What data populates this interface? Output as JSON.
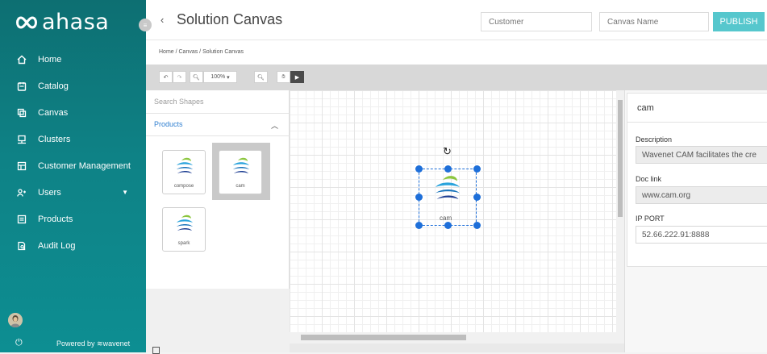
{
  "sidebar": {
    "brand": "ahasa",
    "items": [
      {
        "label": "Home",
        "icon": "home-icon"
      },
      {
        "label": "Catalog",
        "icon": "catalog-icon"
      },
      {
        "label": "Canvas",
        "icon": "canvas-icon"
      },
      {
        "label": "Clusters",
        "icon": "clusters-icon"
      },
      {
        "label": "Customer Management",
        "icon": "customer-management-icon"
      },
      {
        "label": "Users",
        "icon": "users-icon"
      },
      {
        "label": "Products",
        "icon": "products-icon"
      },
      {
        "label": "Audit Log",
        "icon": "audit-log-icon"
      }
    ],
    "powered_by": "Powered by",
    "powered_brand": "wavenet"
  },
  "header": {
    "back_glyph": "‹",
    "title": "Solution Canvas",
    "customer_placeholder": "Customer",
    "canvas_name_placeholder": "Canvas Name",
    "publish_label": "PUBLISH"
  },
  "breadcrumb": "Home / Canvas / Solution Canvas",
  "toolbar": {
    "zoom": "100%"
  },
  "shapes_panel": {
    "search_placeholder": "Search Shapes",
    "section_title": "Products",
    "items": [
      "compose",
      "cam",
      "spark"
    ],
    "selected": "cam"
  },
  "canvas": {
    "node_label": "cam"
  },
  "properties": {
    "title": "cam",
    "description_label": "Description",
    "description_value": "Wavenet CAM facilitates the cre",
    "doc_link_label": "Doc link",
    "doc_link_value": "www.cam.org",
    "ip_port_label": "IP PORT",
    "ip_port_value": "52.66.222.91:8888"
  },
  "colors": {
    "sidebar": "#0e8286",
    "accent": "#56c7cd",
    "selection": "#1e6fd9"
  }
}
